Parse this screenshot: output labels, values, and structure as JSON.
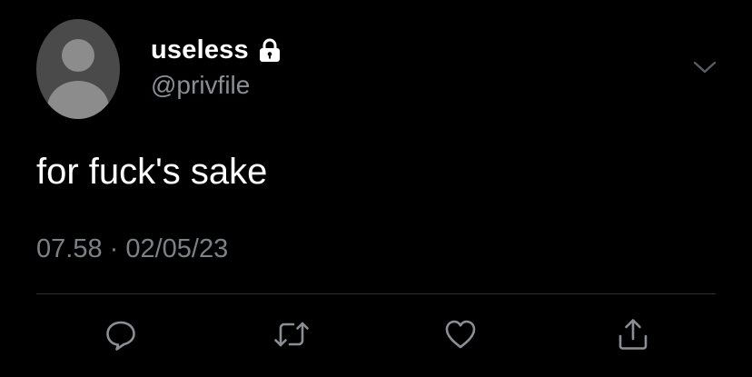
{
  "user": {
    "display_name": "useless",
    "handle": "@privfile",
    "protected_icon": "lock-icon",
    "avatar": "default-avatar"
  },
  "tweet": {
    "text": "for fuck's sake",
    "timestamp": "07.58 · 02/05/23"
  },
  "menu": {
    "icon": "chevron-down-icon"
  },
  "actions": [
    {
      "name": "reply",
      "icon": "speech-bubble-icon"
    },
    {
      "name": "retweet",
      "icon": "retweet-icon"
    },
    {
      "name": "like",
      "icon": "heart-icon"
    },
    {
      "name": "share",
      "icon": "share-icon"
    }
  ],
  "colors": {
    "background": "#000000",
    "primary_text": "#ffffff",
    "secondary_text": "#8b8f94",
    "divider": "#2f3336",
    "icon": "#8b8f94"
  }
}
